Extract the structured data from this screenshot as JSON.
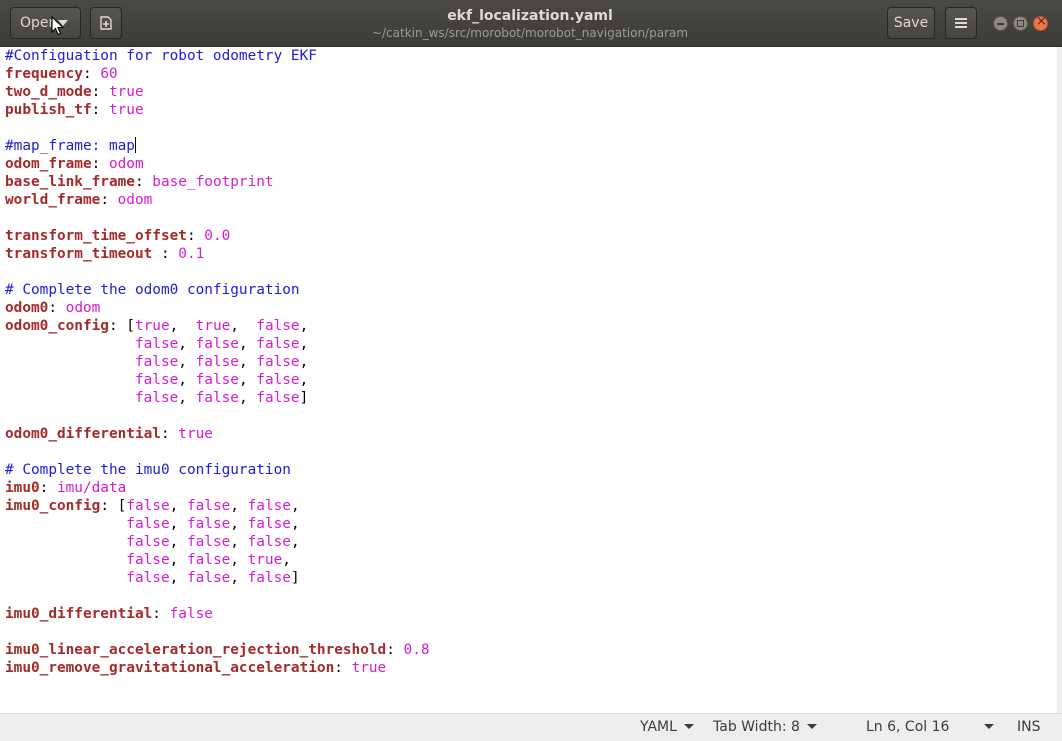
{
  "window": {
    "title": "ekf_localization.yaml",
    "subtitle": "~/catkin_ws/src/morobot/morobot_navigation/param"
  },
  "toolbar": {
    "open_label": "Open",
    "save_label": "Save",
    "new_doc_icon": "new-document-icon",
    "menu_icon": "hamburger-menu-icon"
  },
  "colors": {
    "key": "#a52a2a",
    "value": "#d51bd5",
    "comment": "#1d1dd6",
    "titlebar": "#3c3b37",
    "close": "#f1774b"
  },
  "editor": {
    "lines": [
      [
        [
          "c",
          "#Configuation for robot odometry EKF"
        ]
      ],
      [
        [
          "k",
          "frequency"
        ],
        [
          "p",
          ": "
        ],
        [
          "v",
          "60"
        ]
      ],
      [
        [
          "k",
          "two_d_mode"
        ],
        [
          "p",
          ": "
        ],
        [
          "v",
          "true"
        ]
      ],
      [
        [
          "k",
          "publish_tf"
        ],
        [
          "p",
          ": "
        ],
        [
          "v",
          "true"
        ]
      ],
      [],
      [
        [
          "c",
          "#map_frame: map"
        ],
        [
          "cursor",
          ""
        ]
      ],
      [
        [
          "k",
          "odom_frame"
        ],
        [
          "p",
          ": "
        ],
        [
          "v",
          "odom"
        ]
      ],
      [
        [
          "k",
          "base_link_frame"
        ],
        [
          "p",
          ": "
        ],
        [
          "v",
          "base_footprint"
        ]
      ],
      [
        [
          "k",
          "world_frame"
        ],
        [
          "p",
          ": "
        ],
        [
          "v",
          "odom"
        ]
      ],
      [],
      [
        [
          "k",
          "transform_time_offset"
        ],
        [
          "p",
          ": "
        ],
        [
          "v",
          "0.0"
        ]
      ],
      [
        [
          "k",
          "transform_timeout"
        ],
        [
          "p",
          " : "
        ],
        [
          "v",
          "0.1"
        ]
      ],
      [],
      [
        [
          "c",
          "# Complete the odom0 configuration"
        ]
      ],
      [
        [
          "k",
          "odom0"
        ],
        [
          "p",
          ": "
        ],
        [
          "v",
          "odom"
        ]
      ],
      [
        [
          "k",
          "odom0_config"
        ],
        [
          "p",
          ": ["
        ],
        [
          "v",
          "true"
        ],
        [
          "p",
          ",  "
        ],
        [
          "v",
          "true"
        ],
        [
          "p",
          ",  "
        ],
        [
          "v",
          "false"
        ],
        [
          "p",
          ","
        ]
      ],
      [
        [
          "p",
          "               "
        ],
        [
          "v",
          "false"
        ],
        [
          "p",
          ", "
        ],
        [
          "v",
          "false"
        ],
        [
          "p",
          ", "
        ],
        [
          "v",
          "false"
        ],
        [
          "p",
          ","
        ]
      ],
      [
        [
          "p",
          "               "
        ],
        [
          "v",
          "false"
        ],
        [
          "p",
          ", "
        ],
        [
          "v",
          "false"
        ],
        [
          "p",
          ", "
        ],
        [
          "v",
          "false"
        ],
        [
          "p",
          ","
        ]
      ],
      [
        [
          "p",
          "               "
        ],
        [
          "v",
          "false"
        ],
        [
          "p",
          ", "
        ],
        [
          "v",
          "false"
        ],
        [
          "p",
          ", "
        ],
        [
          "v",
          "false"
        ],
        [
          "p",
          ","
        ]
      ],
      [
        [
          "p",
          "               "
        ],
        [
          "v",
          "false"
        ],
        [
          "p",
          ", "
        ],
        [
          "v",
          "false"
        ],
        [
          "p",
          ", "
        ],
        [
          "v",
          "false"
        ],
        [
          "p",
          "]"
        ]
      ],
      [],
      [
        [
          "k",
          "odom0_differential"
        ],
        [
          "p",
          ": "
        ],
        [
          "v",
          "true"
        ]
      ],
      [],
      [
        [
          "c",
          "# Complete the imu0 configuration"
        ]
      ],
      [
        [
          "k",
          "imu0"
        ],
        [
          "p",
          ": "
        ],
        [
          "v",
          "imu/data"
        ]
      ],
      [
        [
          "k",
          "imu0_config"
        ],
        [
          "p",
          ": ["
        ],
        [
          "v",
          "false"
        ],
        [
          "p",
          ", "
        ],
        [
          "v",
          "false"
        ],
        [
          "p",
          ", "
        ],
        [
          "v",
          "false"
        ],
        [
          "p",
          ","
        ]
      ],
      [
        [
          "p",
          "              "
        ],
        [
          "v",
          "false"
        ],
        [
          "p",
          ", "
        ],
        [
          "v",
          "false"
        ],
        [
          "p",
          ", "
        ],
        [
          "v",
          "false"
        ],
        [
          "p",
          ","
        ]
      ],
      [
        [
          "p",
          "              "
        ],
        [
          "v",
          "false"
        ],
        [
          "p",
          ", "
        ],
        [
          "v",
          "false"
        ],
        [
          "p",
          ", "
        ],
        [
          "v",
          "false"
        ],
        [
          "p",
          ","
        ]
      ],
      [
        [
          "p",
          "              "
        ],
        [
          "v",
          "false"
        ],
        [
          "p",
          ", "
        ],
        [
          "v",
          "false"
        ],
        [
          "p",
          ", "
        ],
        [
          "v",
          "true"
        ],
        [
          "p",
          ","
        ]
      ],
      [
        [
          "p",
          "              "
        ],
        [
          "v",
          "false"
        ],
        [
          "p",
          ", "
        ],
        [
          "v",
          "false"
        ],
        [
          "p",
          ", "
        ],
        [
          "v",
          "false"
        ],
        [
          "p",
          "]"
        ]
      ],
      [],
      [
        [
          "k",
          "imu0_differential"
        ],
        [
          "p",
          ": "
        ],
        [
          "v",
          "false"
        ]
      ],
      [],
      [
        [
          "k",
          "imu0_linear_acceleration_rejection_threshold"
        ],
        [
          "p",
          ": "
        ],
        [
          "v",
          "0.8"
        ]
      ],
      [
        [
          "k",
          "imu0_remove_gravitational_acceleration"
        ],
        [
          "p",
          ": "
        ],
        [
          "v",
          "true"
        ]
      ]
    ]
  },
  "statusbar": {
    "language": "YAML",
    "tab_width": "Tab Width: 8",
    "position": "Ln 6, Col 16",
    "mode": "INS"
  }
}
